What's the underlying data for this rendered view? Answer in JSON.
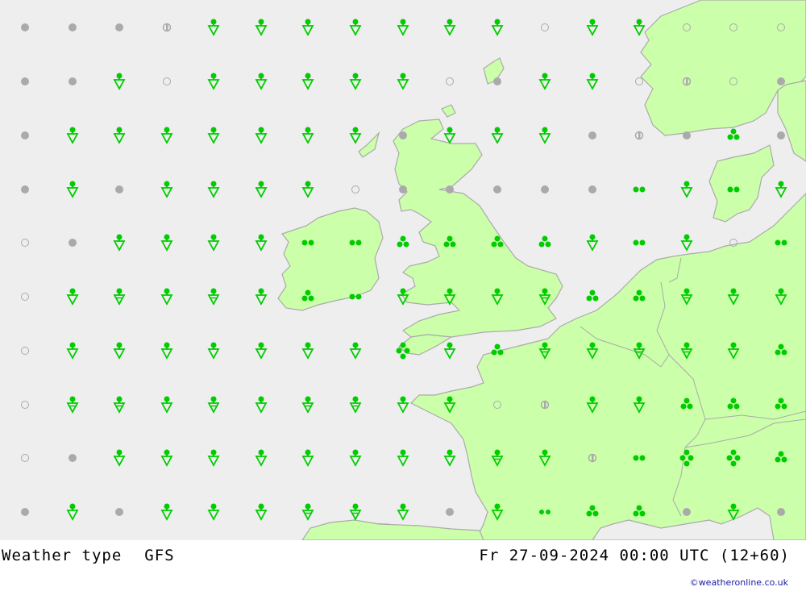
{
  "title": "Weather type",
  "model": "GFS",
  "valid_time": "Fr 27-09-2024 00:00 UTC (12+60)",
  "credit": "©weatheronline.co.uk",
  "colors": {
    "sea": "#eeeeee",
    "land": "#ccffaa",
    "coast": "#aaaaaa",
    "precip": "#00cc00",
    "cloud": "#aaaaaa"
  },
  "legend_symbols": {
    "O": "clear",
    "H": "partly cloudy",
    "D": "overcast",
    "S": "rain showers",
    "S2": "heavy rain showers",
    "RH": "light rain",
    "R2": "moderate rain",
    "R3": "heavy rain",
    "R4": "very heavy rain"
  },
  "grid": {
    "columns": 17,
    "rows": 10,
    "cells": [
      [
        "D",
        "D",
        "D",
        "H",
        "S",
        "S",
        "S",
        "S",
        "S",
        "S",
        "S",
        "O",
        "S",
        "S",
        "O",
        "O",
        "O"
      ],
      [
        "D",
        "D",
        "S",
        "O",
        "S",
        "S",
        "S",
        "S",
        "S",
        "O",
        "D",
        "S",
        "S",
        "O",
        "H",
        "O",
        "D"
      ],
      [
        "D",
        "S",
        "S",
        "S",
        "S",
        "S",
        "S",
        "S",
        "D",
        "S",
        "S",
        "S",
        "D",
        "H",
        "D",
        "R3",
        "D"
      ],
      [
        "D",
        "S",
        "D",
        "S",
        "S",
        "S",
        "S",
        "O",
        "D",
        "D",
        "D",
        "D",
        "D",
        "R2",
        "S",
        "R2",
        "S"
      ],
      [
        "O",
        "D",
        "S",
        "S",
        "S",
        "S",
        "R2",
        "R2",
        "R3",
        "R3",
        "R3",
        "R3",
        "S",
        "R2",
        "S",
        "O",
        "R2"
      ],
      [
        "O",
        "S",
        "S2",
        "S",
        "S2",
        "S",
        "R3",
        "R2",
        "S",
        "S",
        "S",
        "S2",
        "R3",
        "R3",
        "S2",
        "S",
        "S"
      ],
      [
        "O",
        "S",
        "S",
        "S",
        "S",
        "S",
        "S",
        "S",
        "R4",
        "S",
        "R3",
        "S2",
        "S",
        "S2",
        "S2",
        "S",
        "R3"
      ],
      [
        "O",
        "S2",
        "S2",
        "S",
        "S2",
        "S",
        "S2",
        "S2",
        "S",
        "S",
        "O",
        "H",
        "S",
        "S",
        "R3",
        "R3",
        "R3"
      ],
      [
        "O",
        "D",
        "S",
        "S",
        "S",
        "S",
        "S",
        "S",
        "S",
        "S",
        "S2",
        "S",
        "H",
        "R2",
        "R4",
        "R4",
        "R3"
      ],
      [
        "D",
        "S",
        "D",
        "S",
        "S",
        "S",
        "S2",
        "S2",
        "S",
        "D",
        "S",
        "RH",
        "R3",
        "R3",
        "D",
        "S",
        "D"
      ]
    ]
  }
}
